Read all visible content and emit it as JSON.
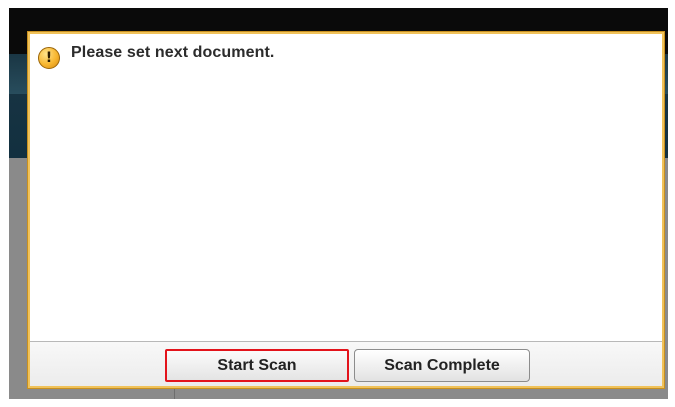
{
  "dialog": {
    "icon": "warning-icon",
    "icon_glyph": "!",
    "message": "Please set next document."
  },
  "buttons": {
    "start_scan": "Start Scan",
    "scan_complete": "Scan Complete"
  },
  "colors": {
    "dialog_border": "#f0c25a",
    "highlight": "#e3131b",
    "warning_icon": "#f7b630"
  }
}
